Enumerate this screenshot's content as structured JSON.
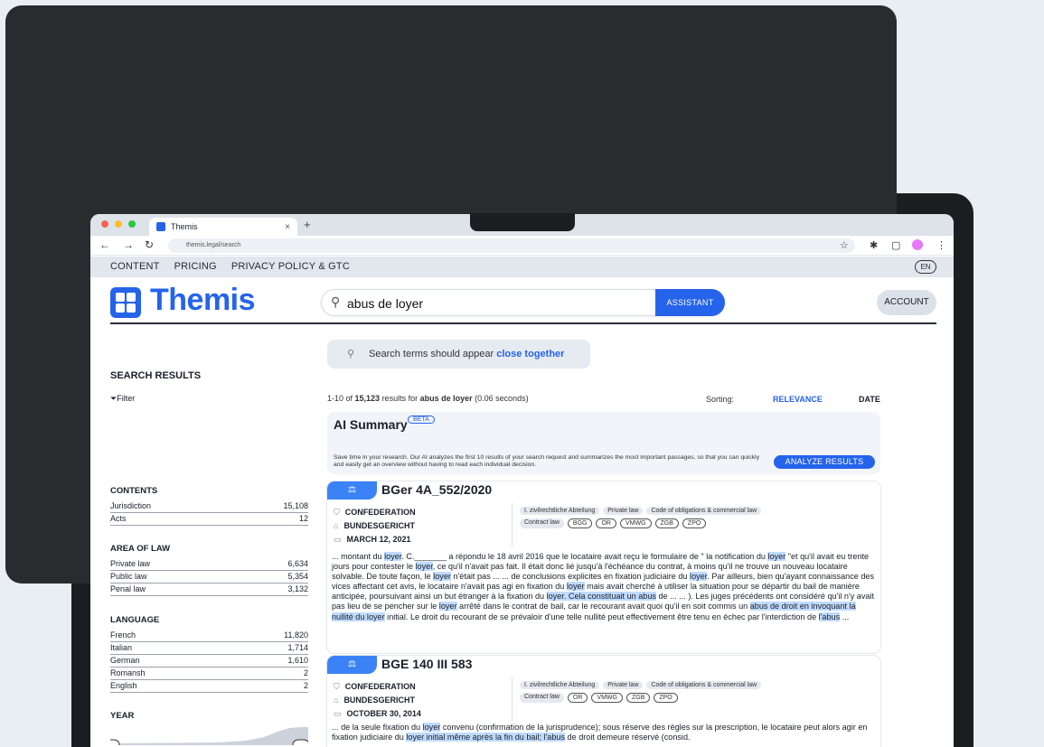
{
  "browser": {
    "tab_title": "Themis",
    "tab_close": "×",
    "new_tab": "+",
    "url": "themis.legal/search",
    "traffic_light_colors": [
      "#ff5f57",
      "#febc2e",
      "#28c840"
    ]
  },
  "nav": {
    "links": [
      "CONTENT",
      "PRICING",
      "PRIVACY POLICY & GTC"
    ],
    "lang": "EN"
  },
  "header": {
    "logo": "Themis",
    "search_query": "abus de loyer",
    "assistant_label": "ASSISTANT",
    "account_label": "ACCOUNT"
  },
  "hint": {
    "prefix": "Search terms should appear ",
    "bold": "close together"
  },
  "sidebar": {
    "title": "SEARCH RESULTS",
    "filter_label": "Filter",
    "facets": [
      {
        "heading": "CONTENTS",
        "rows": [
          [
            "Jurisdiction",
            "15,108"
          ],
          [
            "Acts",
            "12"
          ]
        ]
      },
      {
        "heading": "AREA OF LAW",
        "rows": [
          [
            "Private law",
            "6,634"
          ],
          [
            "Public law",
            "5,354"
          ],
          [
            "Penal law",
            "3,132"
          ]
        ]
      },
      {
        "heading": "LANGUAGE",
        "rows": [
          [
            "French",
            "11,820"
          ],
          [
            "Italian",
            "1,714"
          ],
          [
            "German",
            "1,610"
          ],
          [
            "Romansh",
            "2"
          ],
          [
            "English",
            "2"
          ]
        ]
      },
      {
        "heading": "YEAR",
        "rows": []
      }
    ]
  },
  "results": {
    "meta_prefix": "1-10 of ",
    "meta_count": "15,123",
    "meta_mid": " results for ",
    "meta_query": "abus de loyer",
    "meta_time": " (0.06 seconds)",
    "sorting_label": "Sorting:",
    "sort_relevance": "RELEVANCE",
    "sort_date": "DATE"
  },
  "ai_summary": {
    "title": "AI Summary",
    "beta": "BETA",
    "description": "Save time in your research. Our AI analyzes the first 10 results of your search request and summarizes the most important passages, so that you can quickly and easily get an overview without having to read each individual decision.",
    "button": "ANALYZE RESULTS"
  },
  "cards": [
    {
      "badge": "⚖",
      "title": "BGer 4A_552/2020",
      "info": [
        "CONFEDERATION",
        "BUNDESGERICHT",
        "MARCH 12, 2021"
      ],
      "tags_row1": [
        "I. zivilrechtliche Abteilung",
        "Private law",
        "Code of obligations & commercial law"
      ],
      "tags_row2_filled": [
        "Contract law"
      ],
      "tags_row2_outlined": [
        "BGG",
        "OR",
        "VMWG",
        "ZGB",
        "ZPO"
      ],
      "excerpt": [
        {
          "t": "... montant du "
        },
        {
          "t": "loyer",
          "h": true
        },
        {
          "t": ". C._______ a répondu le 18 avril 2016 que le locataire avait reçu le formulaire de \" la notification du "
        },
        {
          "t": "loyer",
          "h": true
        },
        {
          "t": " \"et qu'il avait eu trente jours pour contester le "
        },
        {
          "t": "loyer",
          "h": true
        },
        {
          "t": ", ce qu'il n'avait pas fait. Il était donc lié jusqu'à l'échéance du contrat, à moins qu'il ne trouve un nouveau locataire solvable. De toute façon, le "
        },
        {
          "t": "loyer",
          "h": true
        },
        {
          "t": " n'était pas ... ... de conclusions explicites en fixation judiciaire du "
        },
        {
          "t": "loyer",
          "h": true
        },
        {
          "t": ". Par ailleurs, bien qu'ayant connaissance des vices affectant cet avis, le locataire n'avait pas agi en fixation du "
        },
        {
          "t": "loyer",
          "h": true
        },
        {
          "t": " mais avait cherché à utiliser la situation pour se départir du bail de manière anticipée, poursuivant ainsi un but étranger à la fixation du "
        },
        {
          "t": "loyer. Cela constituait un abus",
          "h": true
        },
        {
          "t": " de ... ... ). Les juges précédents ont considéré qu'il n'y avait pas lieu de se pencher sur le "
        },
        {
          "t": "loyer",
          "h": true
        },
        {
          "t": " arrêté dans le contrat de bail, car le recourant avait quoi qu'il en soit commis un "
        },
        {
          "t": "abus de droit en invoquant la nullité du loyer",
          "h": true
        },
        {
          "t": " initial. Le droit du recourant de se prévaloir d'une telle nullité peut effectivement être tenu en échec par l'interdiction de "
        },
        {
          "t": "l'abus",
          "h": true
        },
        {
          "t": " ..."
        }
      ]
    },
    {
      "badge": "⚖",
      "title": "BGE 140 III 583",
      "info": [
        "CONFEDERATION",
        "BUNDESGERICHT",
        "OCTOBER 30, 2014"
      ],
      "tags_row1": [
        "I. zivilrechtliche Abteilung",
        "Private law",
        "Code of obligations & commercial law"
      ],
      "tags_row2_filled": [
        "Contract law"
      ],
      "tags_row2_outlined": [
        "OR",
        "VMWG",
        "ZGB",
        "ZPO"
      ],
      "excerpt": [
        {
          "t": "... de la seule fixation du "
        },
        {
          "t": "loyer",
          "h": true
        },
        {
          "t": " convenu (confirmation de la jurisprudence); sous réserve des règles sur la prescription, le locataire peut alors agir en fixation judiciaire du "
        },
        {
          "t": "loyer initial même après la fin du bail; l'abus",
          "h": true
        },
        {
          "t": " de droit demeure réservé (consid."
        }
      ]
    }
  ],
  "colors": {
    "brand": "#2563eb",
    "highlight": "#bfdbfe"
  },
  "icons": [
    "search-icon",
    "filter-icon",
    "scales-icon",
    "shield-icon",
    "building-icon",
    "calendar-icon"
  ]
}
